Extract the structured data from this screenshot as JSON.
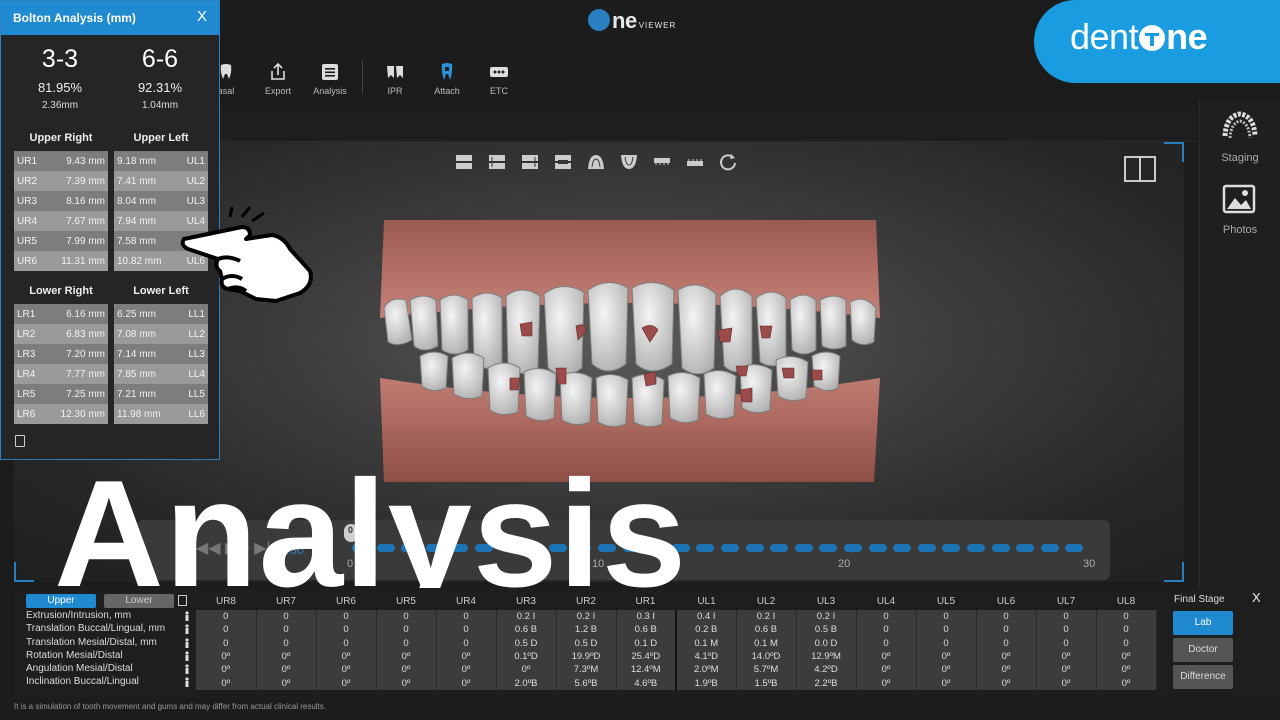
{
  "app": {
    "viewer_logo": "ne",
    "viewer_logo_suffix": "VIEWER",
    "brand_prefix": "dent",
    "brand_suffix": "ne"
  },
  "toolbar": [
    {
      "label": "asal",
      "icon": "tooth-asal-icon"
    },
    {
      "label": "Export",
      "icon": "export-icon"
    },
    {
      "label": "Analysis",
      "icon": "analysis-icon"
    },
    {
      "label": "IPR",
      "icon": "ipr-icon"
    },
    {
      "label": "Attach",
      "icon": "attach-icon"
    },
    {
      "label": "ETC",
      "icon": "etc-icon"
    }
  ],
  "side": {
    "staging": "Staging",
    "photos": "Photos"
  },
  "timeline": {
    "stage_label": "/30",
    "current": "0",
    "ticks": [
      "0",
      "10",
      "20",
      "30"
    ],
    "progress": 0
  },
  "bolton": {
    "title": "Bolton Analysis (mm)",
    "close": "X",
    "ratios": [
      {
        "label": "3-3",
        "percent": "81.95%",
        "mm": "2.36mm"
      },
      {
        "label": "6-6",
        "percent": "92.31%",
        "mm": "1.04mm"
      }
    ],
    "quadrants": {
      "upper_right": {
        "title": "Upper Right",
        "rows": [
          [
            "UR1",
            "9.43 mm"
          ],
          [
            "UR2",
            "7.39 mm"
          ],
          [
            "UR3",
            "8.16 mm"
          ],
          [
            "UR4",
            "7.67 mm"
          ],
          [
            "UR5",
            "7.99 mm"
          ],
          [
            "UR6",
            "11.31 mm"
          ]
        ]
      },
      "upper_left": {
        "title": "Upper Left",
        "rows": [
          [
            "9.18 mm",
            "UL1"
          ],
          [
            "7.41 mm",
            "UL2"
          ],
          [
            "8.04 mm",
            "UL3"
          ],
          [
            "7.94 mm",
            "UL4"
          ],
          [
            "7.58 mm",
            "UL5"
          ],
          [
            "10.82 mm",
            "UL6"
          ]
        ]
      },
      "lower_right": {
        "title": "Lower Right",
        "rows": [
          [
            "LR1",
            "6.16 mm"
          ],
          [
            "LR2",
            "6.83 mm"
          ],
          [
            "LR3",
            "7.20 mm"
          ],
          [
            "LR4",
            "7.77 mm"
          ],
          [
            "LR5",
            "7.25 mm"
          ],
          [
            "LR6",
            "12.30 mm"
          ]
        ]
      },
      "lower_left": {
        "title": "Lower Left",
        "rows": [
          [
            "6.25 mm",
            "LL1"
          ],
          [
            "7.08 mm",
            "LL2"
          ],
          [
            "7.14 mm",
            "LL3"
          ],
          [
            "7.85 mm",
            "LL4"
          ],
          [
            "7.21 mm",
            "LL5"
          ],
          [
            "11.98 mm",
            "LL6"
          ]
        ]
      }
    }
  },
  "overlay_title": "Analysis",
  "movement": {
    "upper_btn": "Upper",
    "lower_btn": "Lower",
    "teeth": [
      "UR8",
      "UR7",
      "UR6",
      "UR5",
      "UR4",
      "UR3",
      "UR2",
      "UR1",
      "UL1",
      "UL2",
      "UL3",
      "UL4",
      "UL5",
      "UL6",
      "UL7",
      "UL8"
    ],
    "rows": [
      {
        "label": "Extrusion/Intrusion, mm",
        "values": [
          "0",
          "0",
          "0",
          "0",
          "0",
          "0.2 I",
          "0.2 I",
          "0.3 I",
          "0.4 I",
          "0.2 I",
          "0.2 I",
          "0",
          "0",
          "0",
          "0",
          "0"
        ]
      },
      {
        "label": "Translation Buccal/Lingual, mm",
        "values": [
          "0",
          "0",
          "0",
          "0",
          "0",
          "0.6 B",
          "1.2 B",
          "0.6 B",
          "0.2 B",
          "0.6 B",
          "0.5 B",
          "0",
          "0",
          "0",
          "0",
          "0"
        ]
      },
      {
        "label": "Translation Mesial/Distal, mm",
        "values": [
          "0",
          "0",
          "0",
          "0",
          "0",
          "0.5 D",
          "0.5 D",
          "0.1 D",
          "0.1 M",
          "0.1 M",
          "0.0 D",
          "0",
          "0",
          "0",
          "0",
          "0"
        ]
      },
      {
        "label": "Rotation Mesial/Distal",
        "values": [
          "0º",
          "0º",
          "0º",
          "0º",
          "0º",
          "0.1ºD",
          "19.9ºD",
          "25.4ºD",
          "4.1ºD",
          "14.0ºD",
          "12.9ºM",
          "0º",
          "0º",
          "0º",
          "0º",
          "0º"
        ]
      },
      {
        "label": "Angulation Mesial/Distal",
        "values": [
          "0º",
          "0º",
          "0º",
          "0º",
          "0º",
          "0º",
          "7.3ºM",
          "12.4ºM",
          "2.0ºM",
          "5.7ºM",
          "4.2ºD",
          "0º",
          "0º",
          "0º",
          "0º",
          "0º"
        ]
      },
      {
        "label": "Inclination Buccal/Lingual",
        "values": [
          "0º",
          "0º",
          "0º",
          "0º",
          "0º",
          "2.0ºB",
          "5.6ºB",
          "4.6ºB",
          "1.9ºB",
          "1.5ºB",
          "2.2ºB",
          "0º",
          "0º",
          "0º",
          "0º",
          "0º"
        ]
      }
    ],
    "final_stage": "Final Stage",
    "close": "X",
    "stage_buttons": [
      "Lab",
      "Doctor",
      "Difference"
    ]
  },
  "disclaimer": "It is a simulation of tooth movement and gums and may differ from actual clinical results.",
  "colors": {
    "accent": "#1f8ad0",
    "brand": "#1a9de0",
    "gum": "#b8736a"
  }
}
